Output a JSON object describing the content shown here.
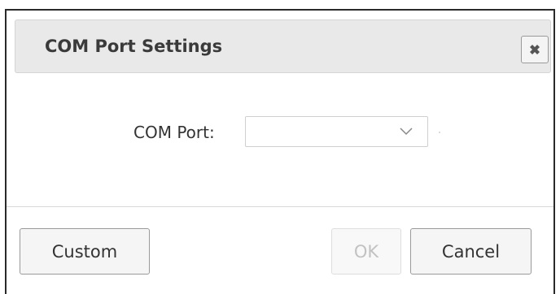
{
  "dialog": {
    "title": "COM Port Settings",
    "close_icon": "close-x-icon"
  },
  "form": {
    "com_port_label": "COM Port:",
    "com_port_value": "",
    "dropdown_icon": "chevron-down-icon"
  },
  "buttons": {
    "custom_label": "Custom",
    "ok_label": "OK",
    "ok_enabled": false,
    "cancel_label": "Cancel"
  }
}
